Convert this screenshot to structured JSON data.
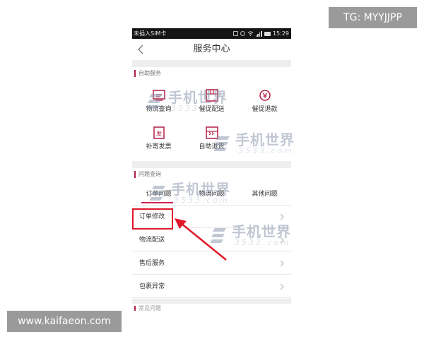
{
  "watermark_tags": {
    "top_right": "TG: MYYJJPP",
    "bottom_left": "www.kaifaeon.com"
  },
  "status_bar": {
    "carrier": "未插入SIM卡",
    "time": "15:29"
  },
  "header": {
    "title": "服务中心"
  },
  "self_service": {
    "section_label": "自助服务",
    "items": [
      {
        "label": "物流查询",
        "icon": "logistics-query-icon"
      },
      {
        "label": "催促配送",
        "icon": "urge-delivery-icon"
      },
      {
        "label": "催促退款",
        "icon": "urge-refund-icon"
      },
      {
        "label": "补寄发票",
        "icon": "reissue-invoice-icon"
      },
      {
        "label": "自助退货",
        "icon": "self-return-icon"
      }
    ]
  },
  "question_query": {
    "section_label": "问题查询",
    "tabs": [
      {
        "label": "订单问题",
        "active": true
      },
      {
        "label": "物流问题",
        "active": false
      },
      {
        "label": "其他问题",
        "active": false
      }
    ],
    "rows": [
      {
        "label": "订单修改"
      },
      {
        "label": "物流配送"
      },
      {
        "label": "售后服务"
      },
      {
        "label": "包裹异常"
      }
    ]
  },
  "bottom_section_label": "常见问题",
  "site_watermark": {
    "name": "手机世界",
    "domain": "3533.com"
  },
  "colors": {
    "accent": "#b41e46",
    "active_tab": "#d02050",
    "annotation": "#e0182a"
  }
}
